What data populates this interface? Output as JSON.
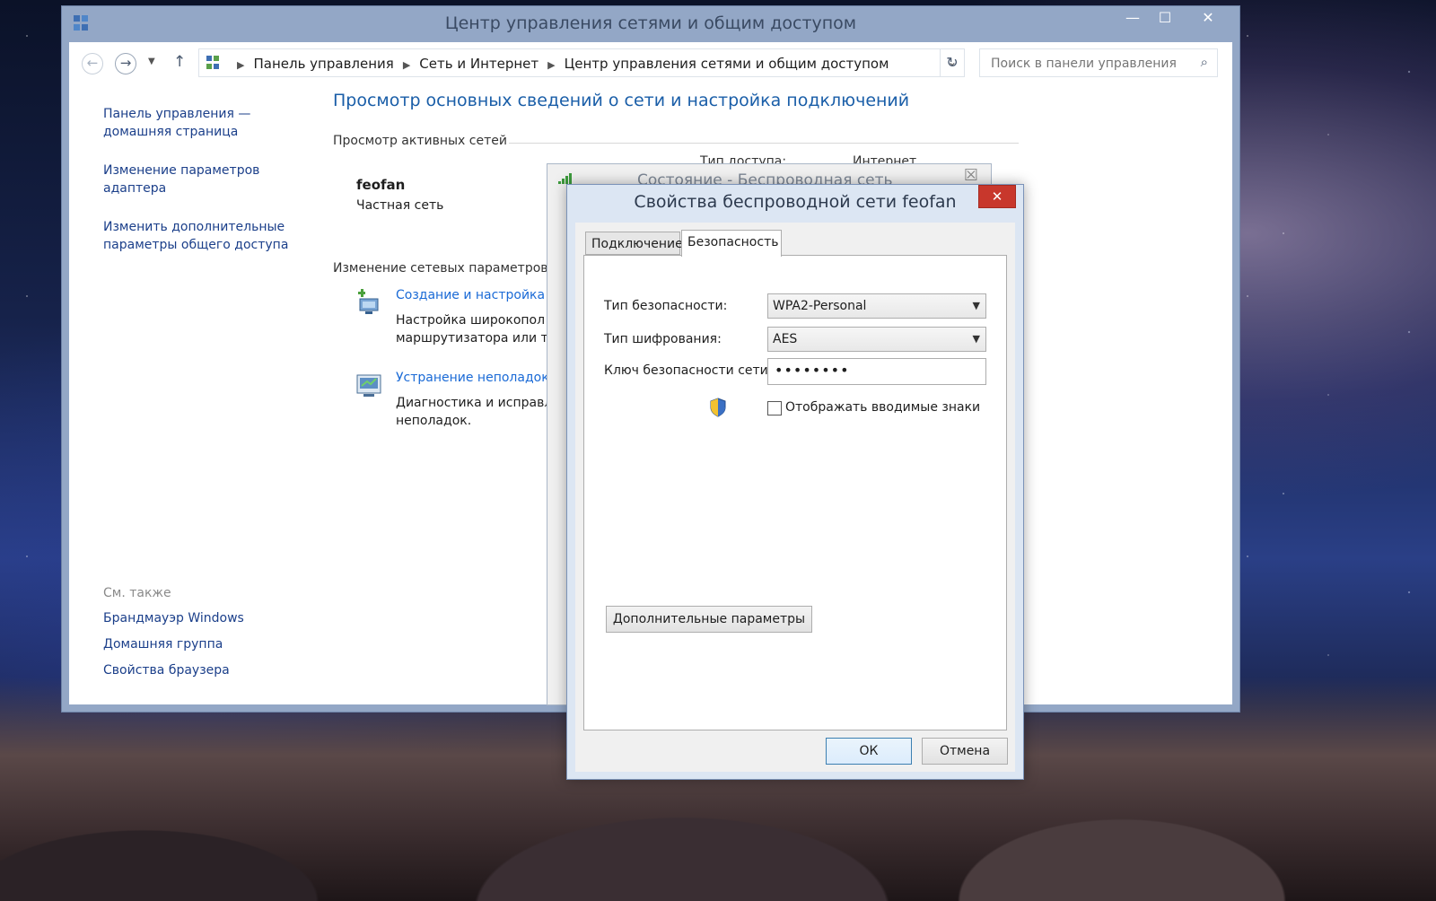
{
  "window": {
    "title": "Центр управления сетями и общим доступом",
    "minimize": "—",
    "maximize": "☐",
    "close": "✕"
  },
  "address": {
    "crumbs": [
      "Панель управления",
      "Сеть и Интернет",
      "Центр управления сетями и общим доступом"
    ],
    "search_placeholder": "Поиск в панели управления"
  },
  "sidebar": {
    "links": [
      "Панель управления — домашняя страница",
      "Изменение параметров адаптера",
      "Изменить дополнительные параметры общего доступа"
    ],
    "see_also_header": "См. также",
    "see_also": [
      "Брандмауэр Windows",
      "Домашняя группа",
      "Свойства браузера"
    ]
  },
  "main": {
    "title": "Просмотр основных сведений о сети и настройка подключений",
    "active_networks_header": "Просмотр активных сетей",
    "network_name": "feofan",
    "network_type": "Частная сеть",
    "access_type_label": "Тип доступа:",
    "access_type_value": "Интернет",
    "change_header": "Изменение сетевых параметров",
    "tasks": [
      {
        "link": "Создание и настройка н",
        "desc1": "Настройка широкопол",
        "desc2": "маршрутизатора или т"
      },
      {
        "link": "Устранение неполадок",
        "desc1": "Диагностика и исправл",
        "desc2": "неполадок."
      }
    ]
  },
  "status_dialog": {
    "title": "Состояние - Беспроводная сеть"
  },
  "dialog": {
    "title": "Свойства беспроводной сети feofan",
    "close": "✕",
    "tabs": [
      "Подключение",
      "Безопасность"
    ],
    "active_tab": "Безопасность",
    "security_type_label": "Тип безопасности:",
    "security_type_value": "WPA2-Personal",
    "encryption_type_label": "Тип шифрования:",
    "encryption_type_value": "AES",
    "key_label": "Ключ безопасности сети",
    "key_value": "••••••••",
    "show_chars_label": "Отображать вводимые знаки",
    "show_chars_checked": false,
    "advanced_button": "Дополнительные параметры",
    "ok_button": "ОК",
    "cancel_button": "Отмена"
  },
  "colors": {
    "link": "#1b3f8a",
    "title_blue": "#1a5ea8",
    "close_red": "#c8372c"
  }
}
